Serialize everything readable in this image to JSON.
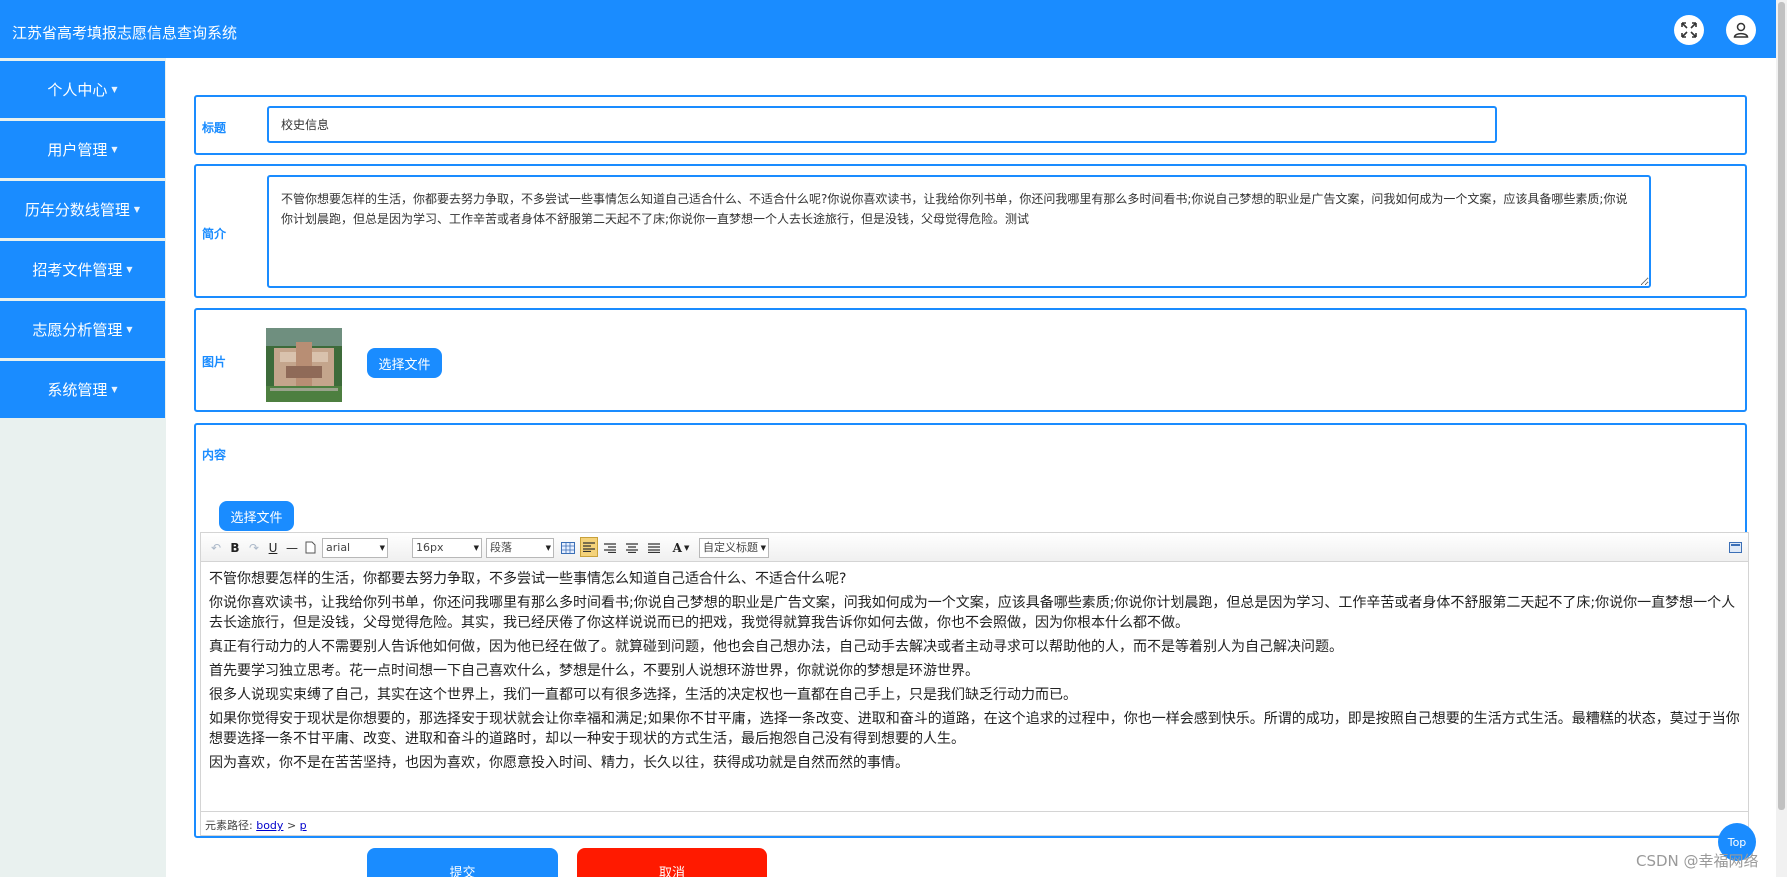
{
  "header": {
    "title": "江苏省高考填报志愿信息查询系统",
    "fullscreen_icon": "fullscreen-icon",
    "user_icon": "user-icon"
  },
  "sidebar": {
    "items": [
      {
        "label": "个人中心"
      },
      {
        "label": "用户管理"
      },
      {
        "label": "历年分数线管理"
      },
      {
        "label": "招考文件管理"
      },
      {
        "label": "志愿分析管理"
      },
      {
        "label": "系统管理"
      }
    ]
  },
  "form": {
    "title_label": "标题",
    "title_value": "校史信息",
    "intro_label": "简介",
    "intro_value": "不管你想要怎样的生活，你都要去努力争取，不多尝试一些事情怎么知道自己适合什么、不适合什么呢?你说你喜欢读书，让我给你列书单，你还问我哪里有那么多时间看书;你说自己梦想的职业是广告文案，问我如何成为一个文案，应该具备哪些素质;你说你计划晨跑，但总是因为学习、工作辛苦或者身体不舒服第二天起不了床;你说你一直梦想一个人去长途旅行，但是没钱，父母觉得危险。测试",
    "image_label": "图片",
    "choose_file_label": "选择文件",
    "content_label": "内容",
    "content_choose_file_label": "选择文件"
  },
  "editor": {
    "toolbar": {
      "font_family": "arial",
      "font_size": "16px",
      "paragraph": "段落",
      "custom_heading": "自定义标题",
      "bold": "B",
      "underline": "U",
      "font_color": "A"
    },
    "paragraphs": [
      "不管你想要怎样的生活，你都要去努力争取，不多尝试一些事情怎么知道自己适合什么、不适合什么呢?",
      "你说你喜欢读书，让我给你列书单，你还问我哪里有那么多时间看书;你说自己梦想的职业是广告文案，问我如何成为一个文案，应该具备哪些素质;你说你计划晨跑，但总是因为学习、工作辛苦或者身体不舒服第二天起不了床;你说你一直梦想一个人去长途旅行，但是没钱，父母觉得危险。其实，我已经厌倦了你这样说说而已的把戏，我觉得就算我告诉你如何去做，你也不会照做，因为你根本什么都不做。",
      "真正有行动力的人不需要别人告诉他如何做，因为他已经在做了。就算碰到问题，他也会自己想办法，自己动手去解决或者主动寻求可以帮助他的人，而不是等着别人为自己解决问题。",
      "首先要学习独立思考。花一点时间想一下自己喜欢什么，梦想是什么，不要别人说想环游世界，你就说你的梦想是环游世界。",
      "很多人说现实束缚了自己，其实在这个世界上，我们一直都可以有很多选择，生活的决定权也一直都在自己手上，只是我们缺乏行动力而已。",
      "如果你觉得安于现状是你想要的，那选择安于现状就会让你幸福和满足;如果你不甘平庸，选择一条改变、进取和奋斗的道路，在这个追求的过程中，你也一样会感到快乐。所谓的成功，即是按照自己想要的生活方式生活。最糟糕的状态，莫过于当你想要选择一条不甘平庸、改变、进取和奋斗的道路时，却以一种安于现状的方式生活，最后抱怨自己没有得到想要的人生。",
      "因为喜欢，你不是在苦苦坚持，也因为喜欢，你愿意投入时间、精力，长久以往，获得成功就是自然而然的事情。"
    ],
    "status_prefix": "元素路径:",
    "status_body": "body",
    "status_sep": ">",
    "status_p": "p"
  },
  "actions": {
    "submit": "提交",
    "cancel": "取消",
    "top": "Top"
  },
  "watermark": "CSDN @幸福网络",
  "colors": {
    "primary": "#1a8cff",
    "cancel": "#ff1a00",
    "sidebar_bg": "#e9f1ef"
  }
}
